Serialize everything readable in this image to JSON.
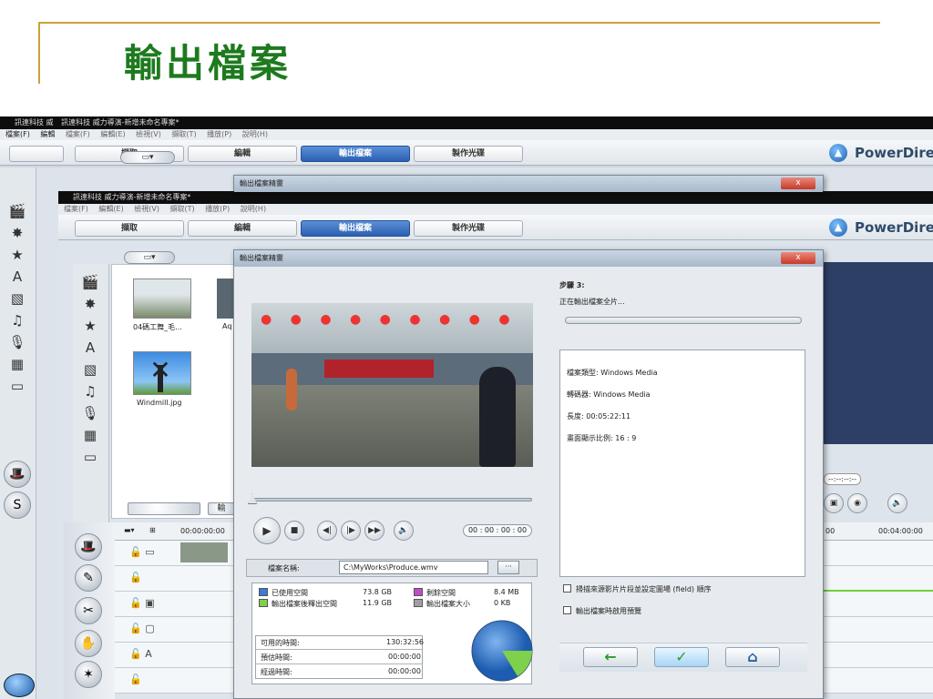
{
  "slide": {
    "title": "輸出檔案"
  },
  "app": {
    "window_title": "訊連科技 威力導演-新增未命名專案*",
    "window_title_short": "訊連科技 威",
    "menu": [
      "檔案(F)",
      "編輯(E)",
      "檢視(V)",
      "擷取(T)",
      "播放(P)",
      "說明(H)"
    ],
    "menu_short": [
      "檔案(F)",
      "編輯"
    ],
    "tabs": [
      "擷取",
      "編輯",
      "輸出檔案",
      "製作光碟"
    ],
    "active_tab": "輸出檔案",
    "brand": "PowerDire"
  },
  "library": {
    "items": [
      {
        "label": "04碼工舞_毛..."
      },
      {
        "label": "Windmill.jpg"
      },
      {
        "label": "Aq"
      }
    ],
    "back_tab_partial": "輸"
  },
  "timeline": {
    "time_start": "00:00:00:00",
    "time_right": "00:04:00:00",
    "time_right_prefix": "00",
    "timecode_field": "--:--:--:--"
  },
  "dialog": {
    "title": "輸出檔案精靈",
    "close_label": "x",
    "player_timecode": "00 : 00 : 00 : 00",
    "filename_label": "檔案名稱:",
    "filename_value": "C:\\MyWorks\\Produce.wmv",
    "browse_label": "···",
    "space": {
      "used_label": "已使用空間",
      "used_value": "73.8 GB",
      "free_label": "剩餘空間",
      "free_value": "8.4 MB",
      "after_label": "輸出檔案後釋出空間",
      "after_value": "11.9 GB",
      "output_label": "輸出檔案大小",
      "output_value": "0 KB"
    },
    "times": [
      {
        "label": "可用的時間:",
        "value": "130:32:56"
      },
      {
        "label": "預估時間:",
        "value": "00:00:00"
      },
      {
        "label": "經過時間:",
        "value": "00:00:00"
      }
    ],
    "step_label": "步驟 3:",
    "step_desc": "正在輸出檔案全片...",
    "info": [
      "檔案類型: Windows Media",
      "轉碼器: Windows Media",
      "長度: 00:05:22:11",
      "畫面顯示比例: 16 : 9"
    ],
    "checkbox1": "掃描來源影片片段並設定圖場 (field) 順序",
    "checkbox2": "輸出檔案時啟用預覽",
    "nav_back": "←",
    "nav_ok": "✓",
    "nav_home": "⌂",
    "progress": 0.0
  },
  "colors": {
    "title_green": "#1e7a1e",
    "accent_gold": "#c8a23a",
    "used_blue": "#3a7ad8",
    "free_purple": "#c04cc8",
    "after_green": "#7fd04a",
    "output_gray": "#a0a0a0"
  }
}
